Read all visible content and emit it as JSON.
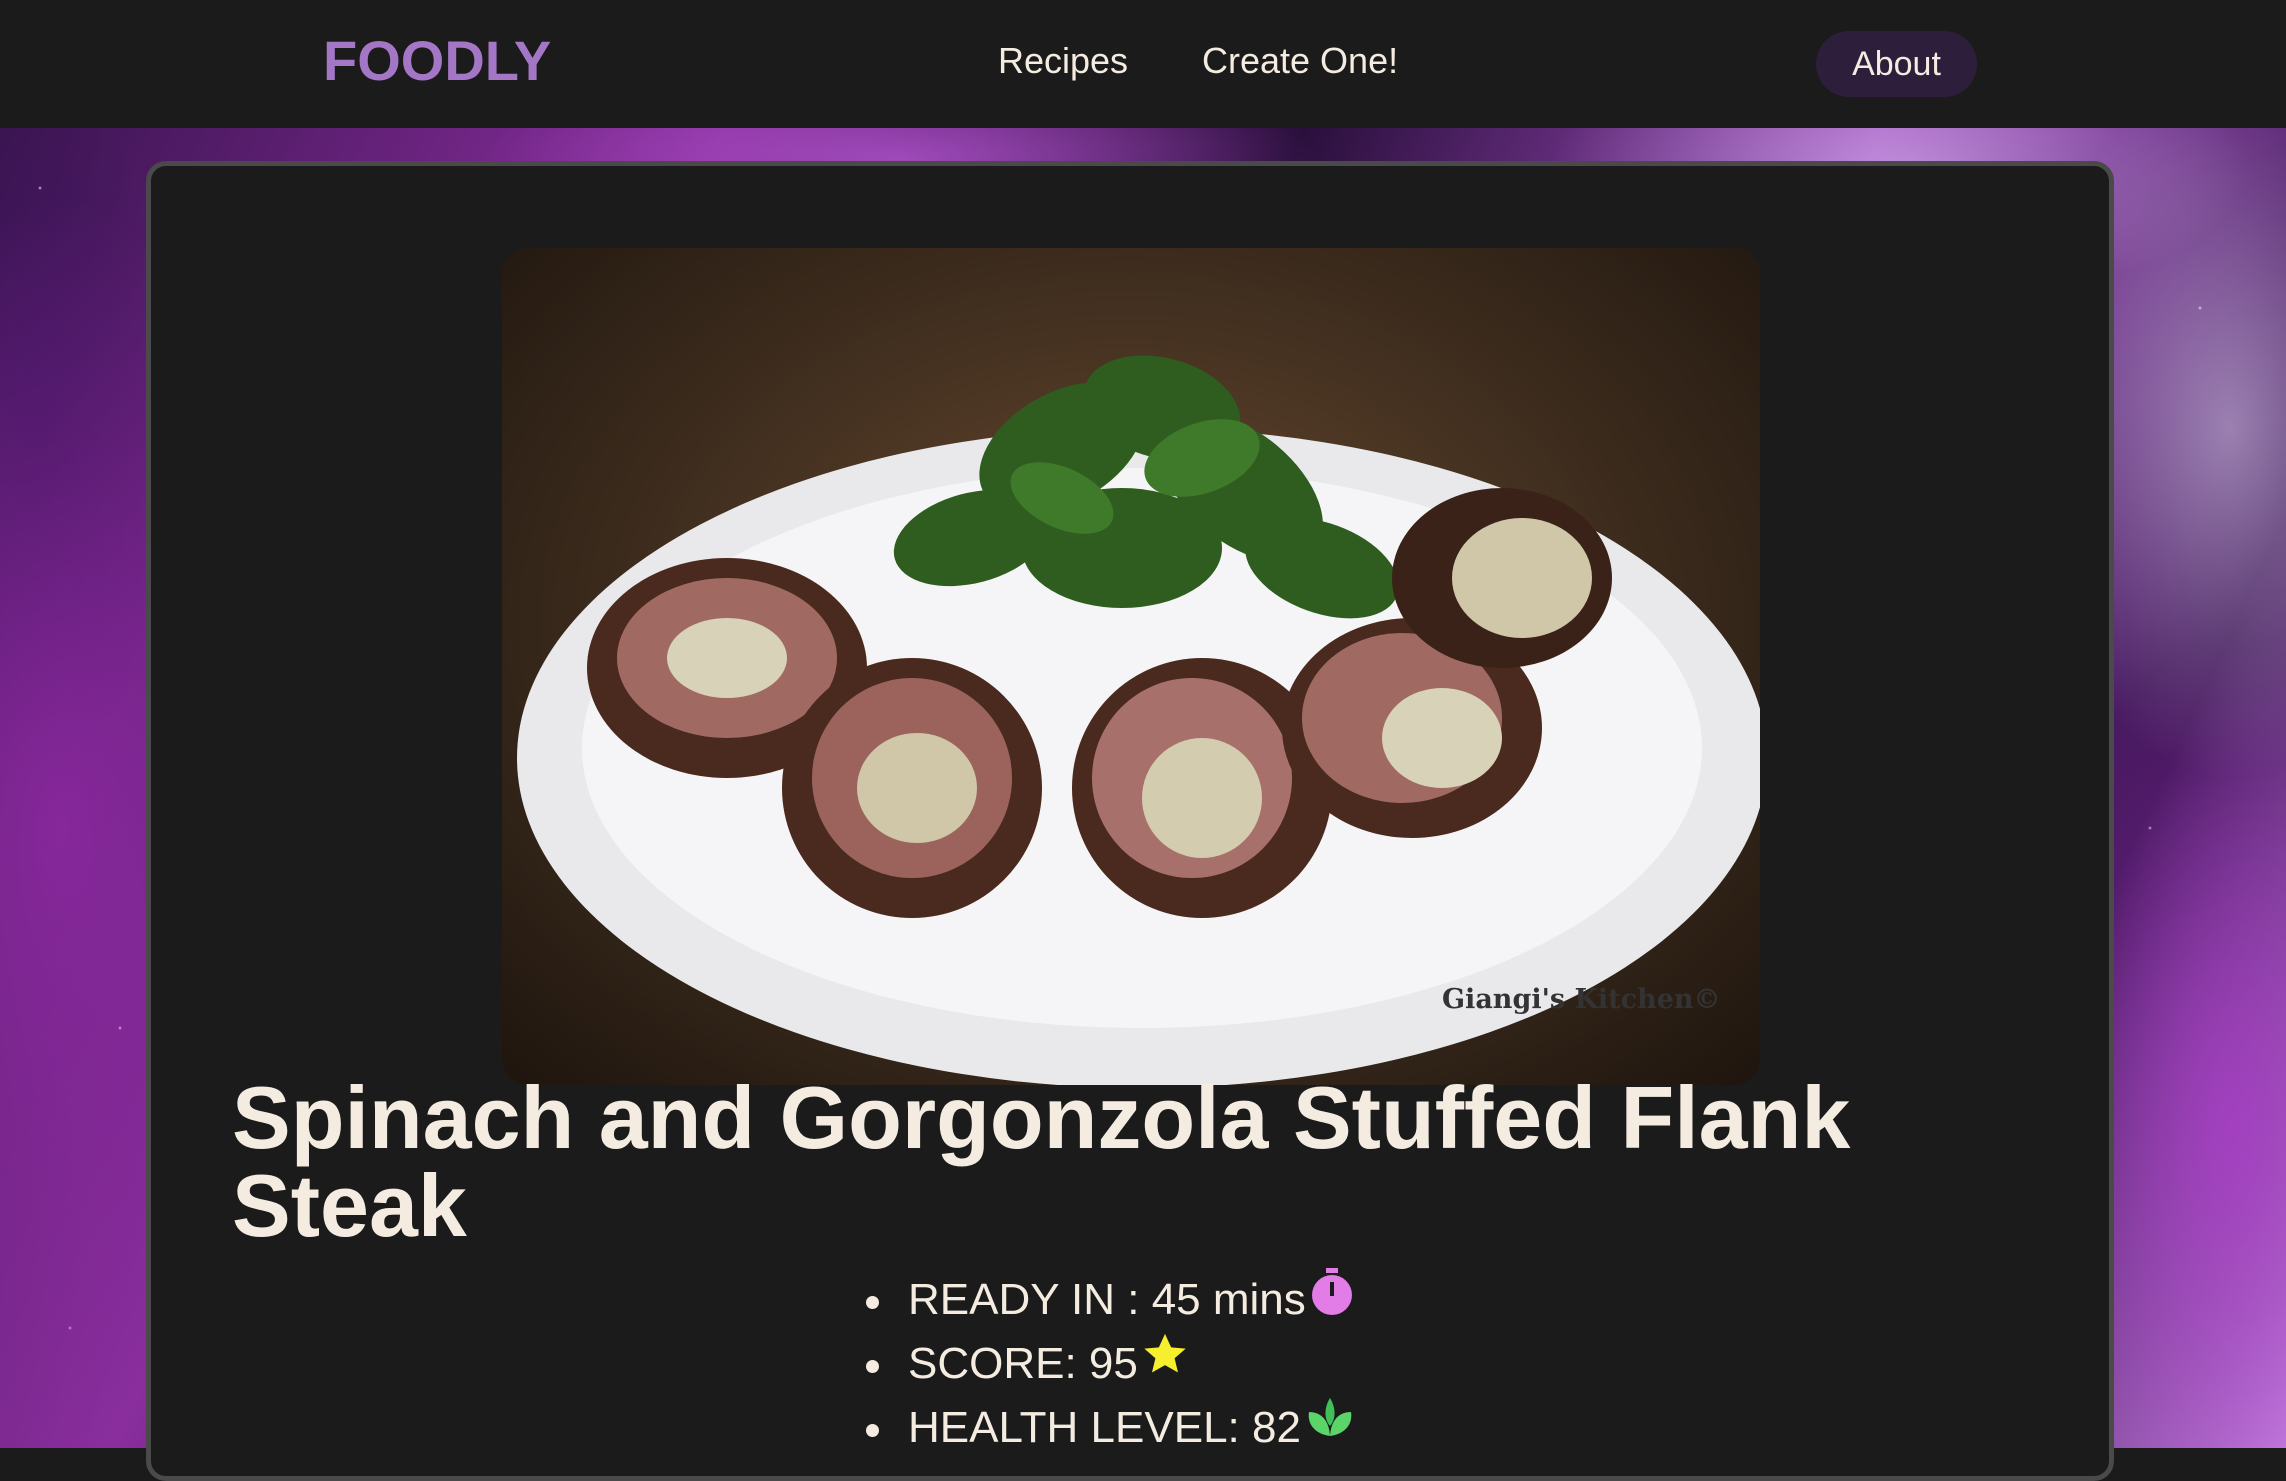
{
  "brand": "FOODLY",
  "nav": {
    "recipes": "Recipes",
    "create": "Create One!",
    "about": "About"
  },
  "recipe": {
    "image_watermark": "Giangi's Kitchen©",
    "title": "Spinach and Gorgonzola Stuffed Flank Steak",
    "stats": [
      {
        "label": "READY IN : 45 mins",
        "icon": "stopwatch-icon",
        "color": "#e27ce6"
      },
      {
        "label": "SCORE: 95",
        "icon": "star-icon",
        "color": "#f5ef2d"
      },
      {
        "label": "HEALTH LEVEL: 82",
        "icon": "leaf-icon",
        "color": "#5bd46a"
      }
    ]
  },
  "colors": {
    "brand": "#a477c6",
    "background": "#1b1b1b",
    "text": "#f4ece0",
    "about_button": "#2d1f3c"
  }
}
